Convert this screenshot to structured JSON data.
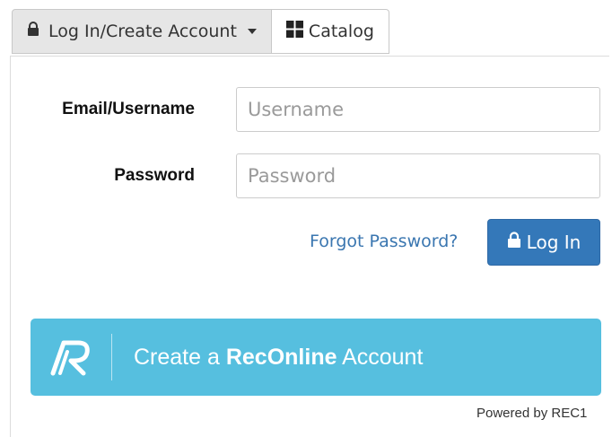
{
  "toolbar": {
    "login_toggle_label": "Log In/Create Account",
    "catalog_label": "Catalog"
  },
  "login_form": {
    "username_label": "Email/Username",
    "username_placeholder": "Username",
    "password_label": "Password",
    "password_placeholder": "Password",
    "forgot_password_label": "Forgot Password?",
    "login_button_label": "Log In"
  },
  "create_account": {
    "prefix": "Create a ",
    "brand": "RecOnline",
    "suffix": " Account"
  },
  "footer": {
    "powered_by": "Powered by REC1"
  },
  "colors": {
    "primary_button": "#3478b9",
    "create_account_bg": "#56bfdf",
    "link": "#3a76b0"
  },
  "icons": {
    "login_toggle": "lock-icon",
    "catalog": "grid-icon",
    "login_button": "lock-icon",
    "create_account": "reconline-logo"
  }
}
